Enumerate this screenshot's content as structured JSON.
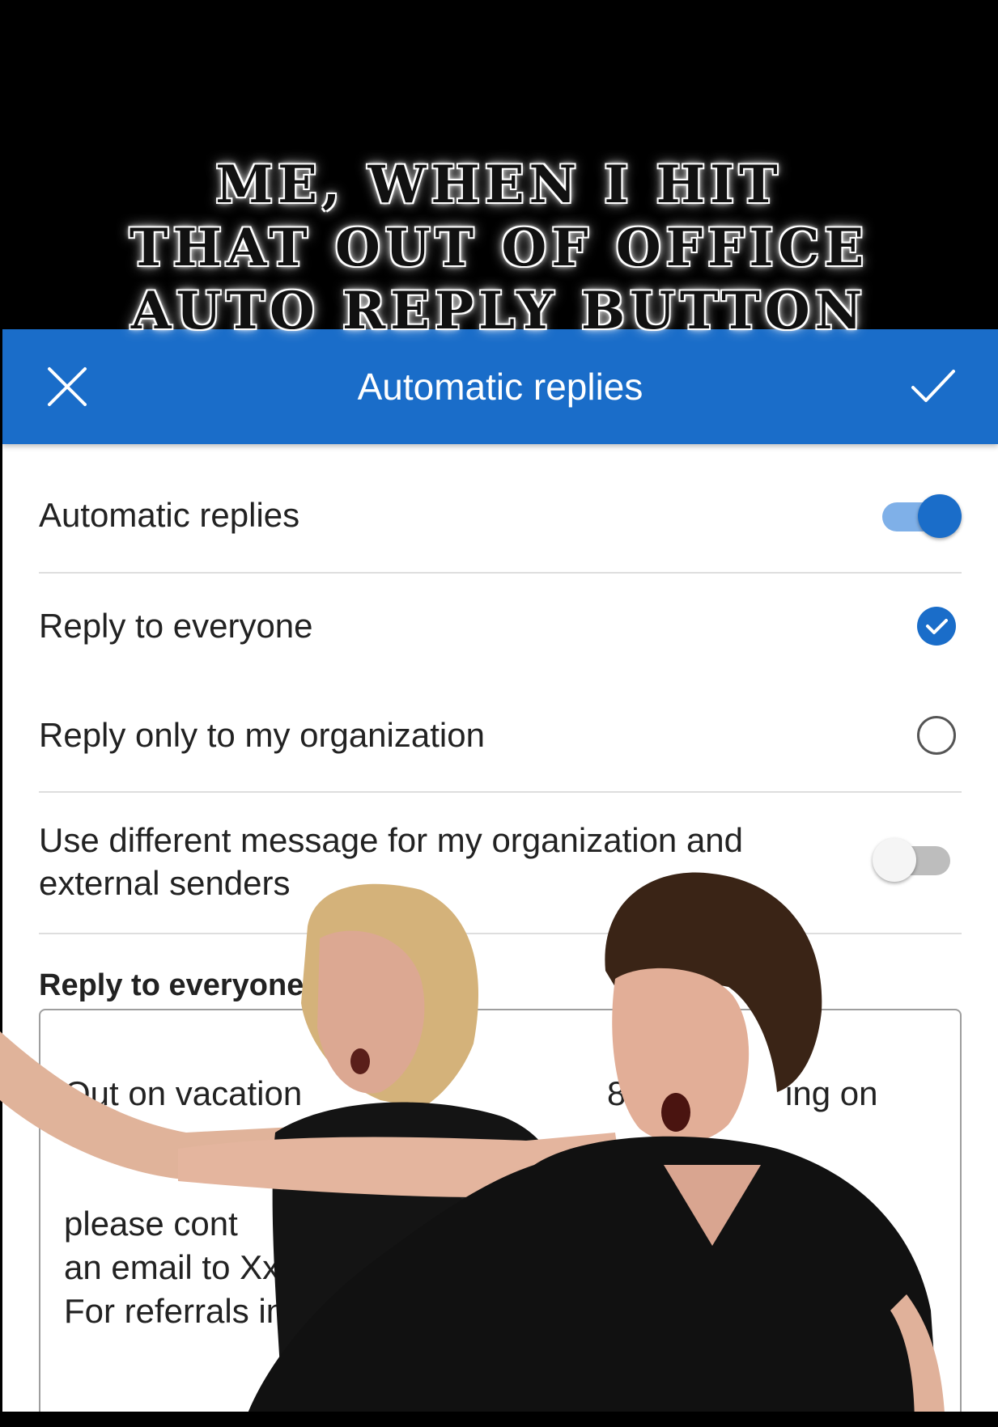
{
  "caption": {
    "lines": [
      "ME, WHEN I HIT",
      "THAT OUT OF OFFICE",
      "AUTO REPLY BUTTON"
    ]
  },
  "appbar": {
    "title": "Automatic replies",
    "close_icon": "close-icon",
    "save_icon": "checkmark-icon",
    "color": "#1a6dc9"
  },
  "settings": {
    "automatic_replies": {
      "label": "Automatic replies",
      "enabled": true
    },
    "reply_everyone": {
      "label": "Reply to everyone",
      "selected": true
    },
    "reply_org": {
      "label": "Reply only to my organization",
      "selected": false
    },
    "different_message": {
      "label_line1": "Use different message for my organization and",
      "label_line2": "external senders",
      "enabled": false
    }
  },
  "message": {
    "heading": "Reply to everyone",
    "lines": [
      "Out on vacation",
      "8/",
      "ing on",
      "please cont",
      "an email to Xx",
      "For referrals inq"
    ]
  }
}
